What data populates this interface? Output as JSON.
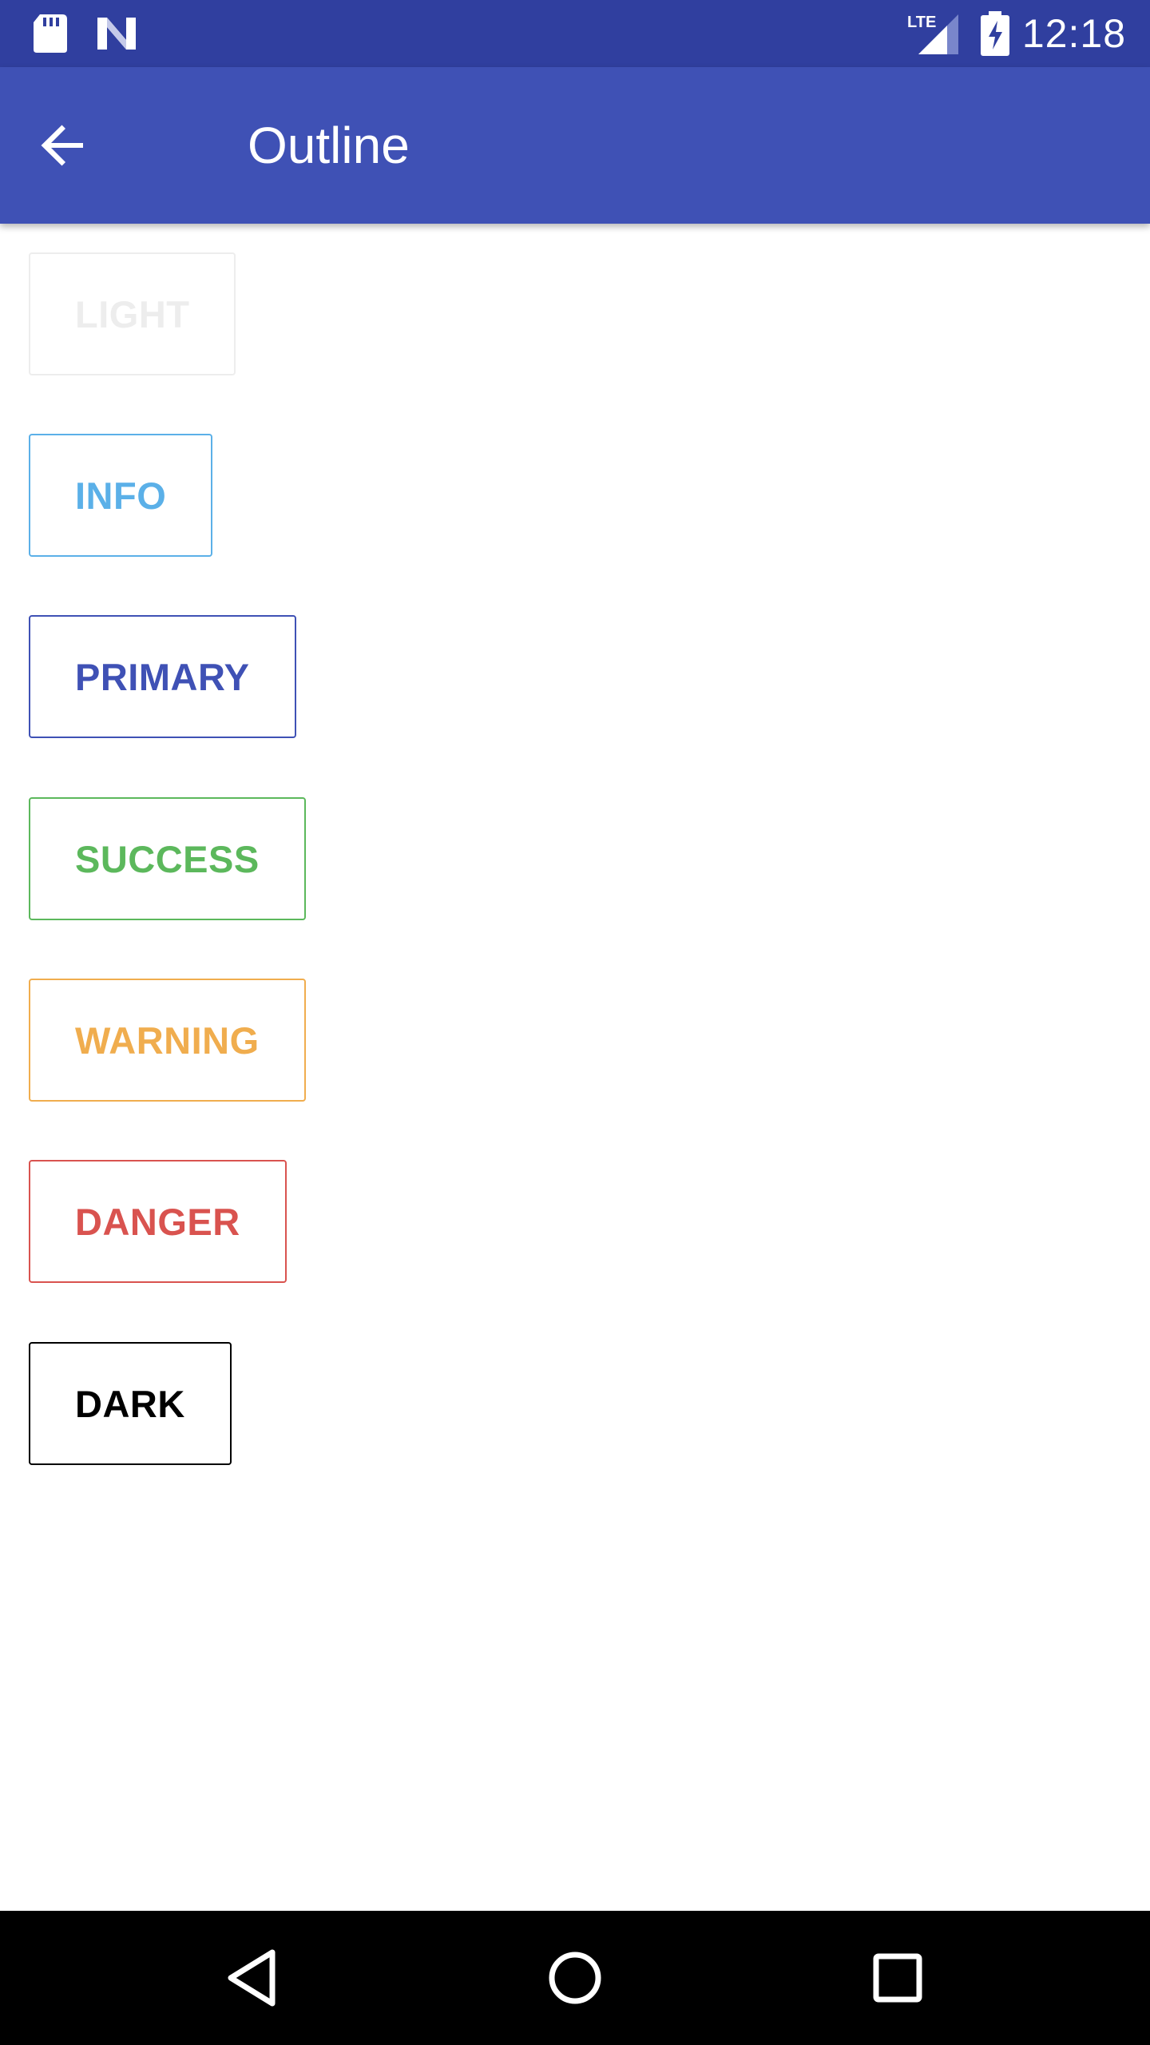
{
  "status_bar": {
    "time": "12:18",
    "lte_label": "LTE",
    "bg_color": "#303f9f",
    "icons": [
      "sd-card-icon",
      "notification-n-icon",
      "lte-signal-icon",
      "battery-charging-icon"
    ]
  },
  "app_bar": {
    "title": "Outline",
    "bg_color": "#3f51b5",
    "back_icon": "arrow-back-icon"
  },
  "buttons": [
    {
      "id": "light",
      "label": "LIGHT",
      "color": "#ededed"
    },
    {
      "id": "info",
      "label": "INFO",
      "color": "#5bb0e8"
    },
    {
      "id": "primary",
      "label": "PRIMARY",
      "color": "#3f51b5"
    },
    {
      "id": "success",
      "label": "SUCCESS",
      "color": "#5cb85c"
    },
    {
      "id": "warning",
      "label": "WARNING",
      "color": "#f0ad4e"
    },
    {
      "id": "danger",
      "label": "DANGER",
      "color": "#d9534f"
    },
    {
      "id": "dark",
      "label": "DARK",
      "color": "#000000"
    }
  ],
  "nav_bar": {
    "bg_color": "#000000",
    "icons": [
      "back-triangle-icon",
      "home-circle-icon",
      "recents-square-icon"
    ]
  }
}
